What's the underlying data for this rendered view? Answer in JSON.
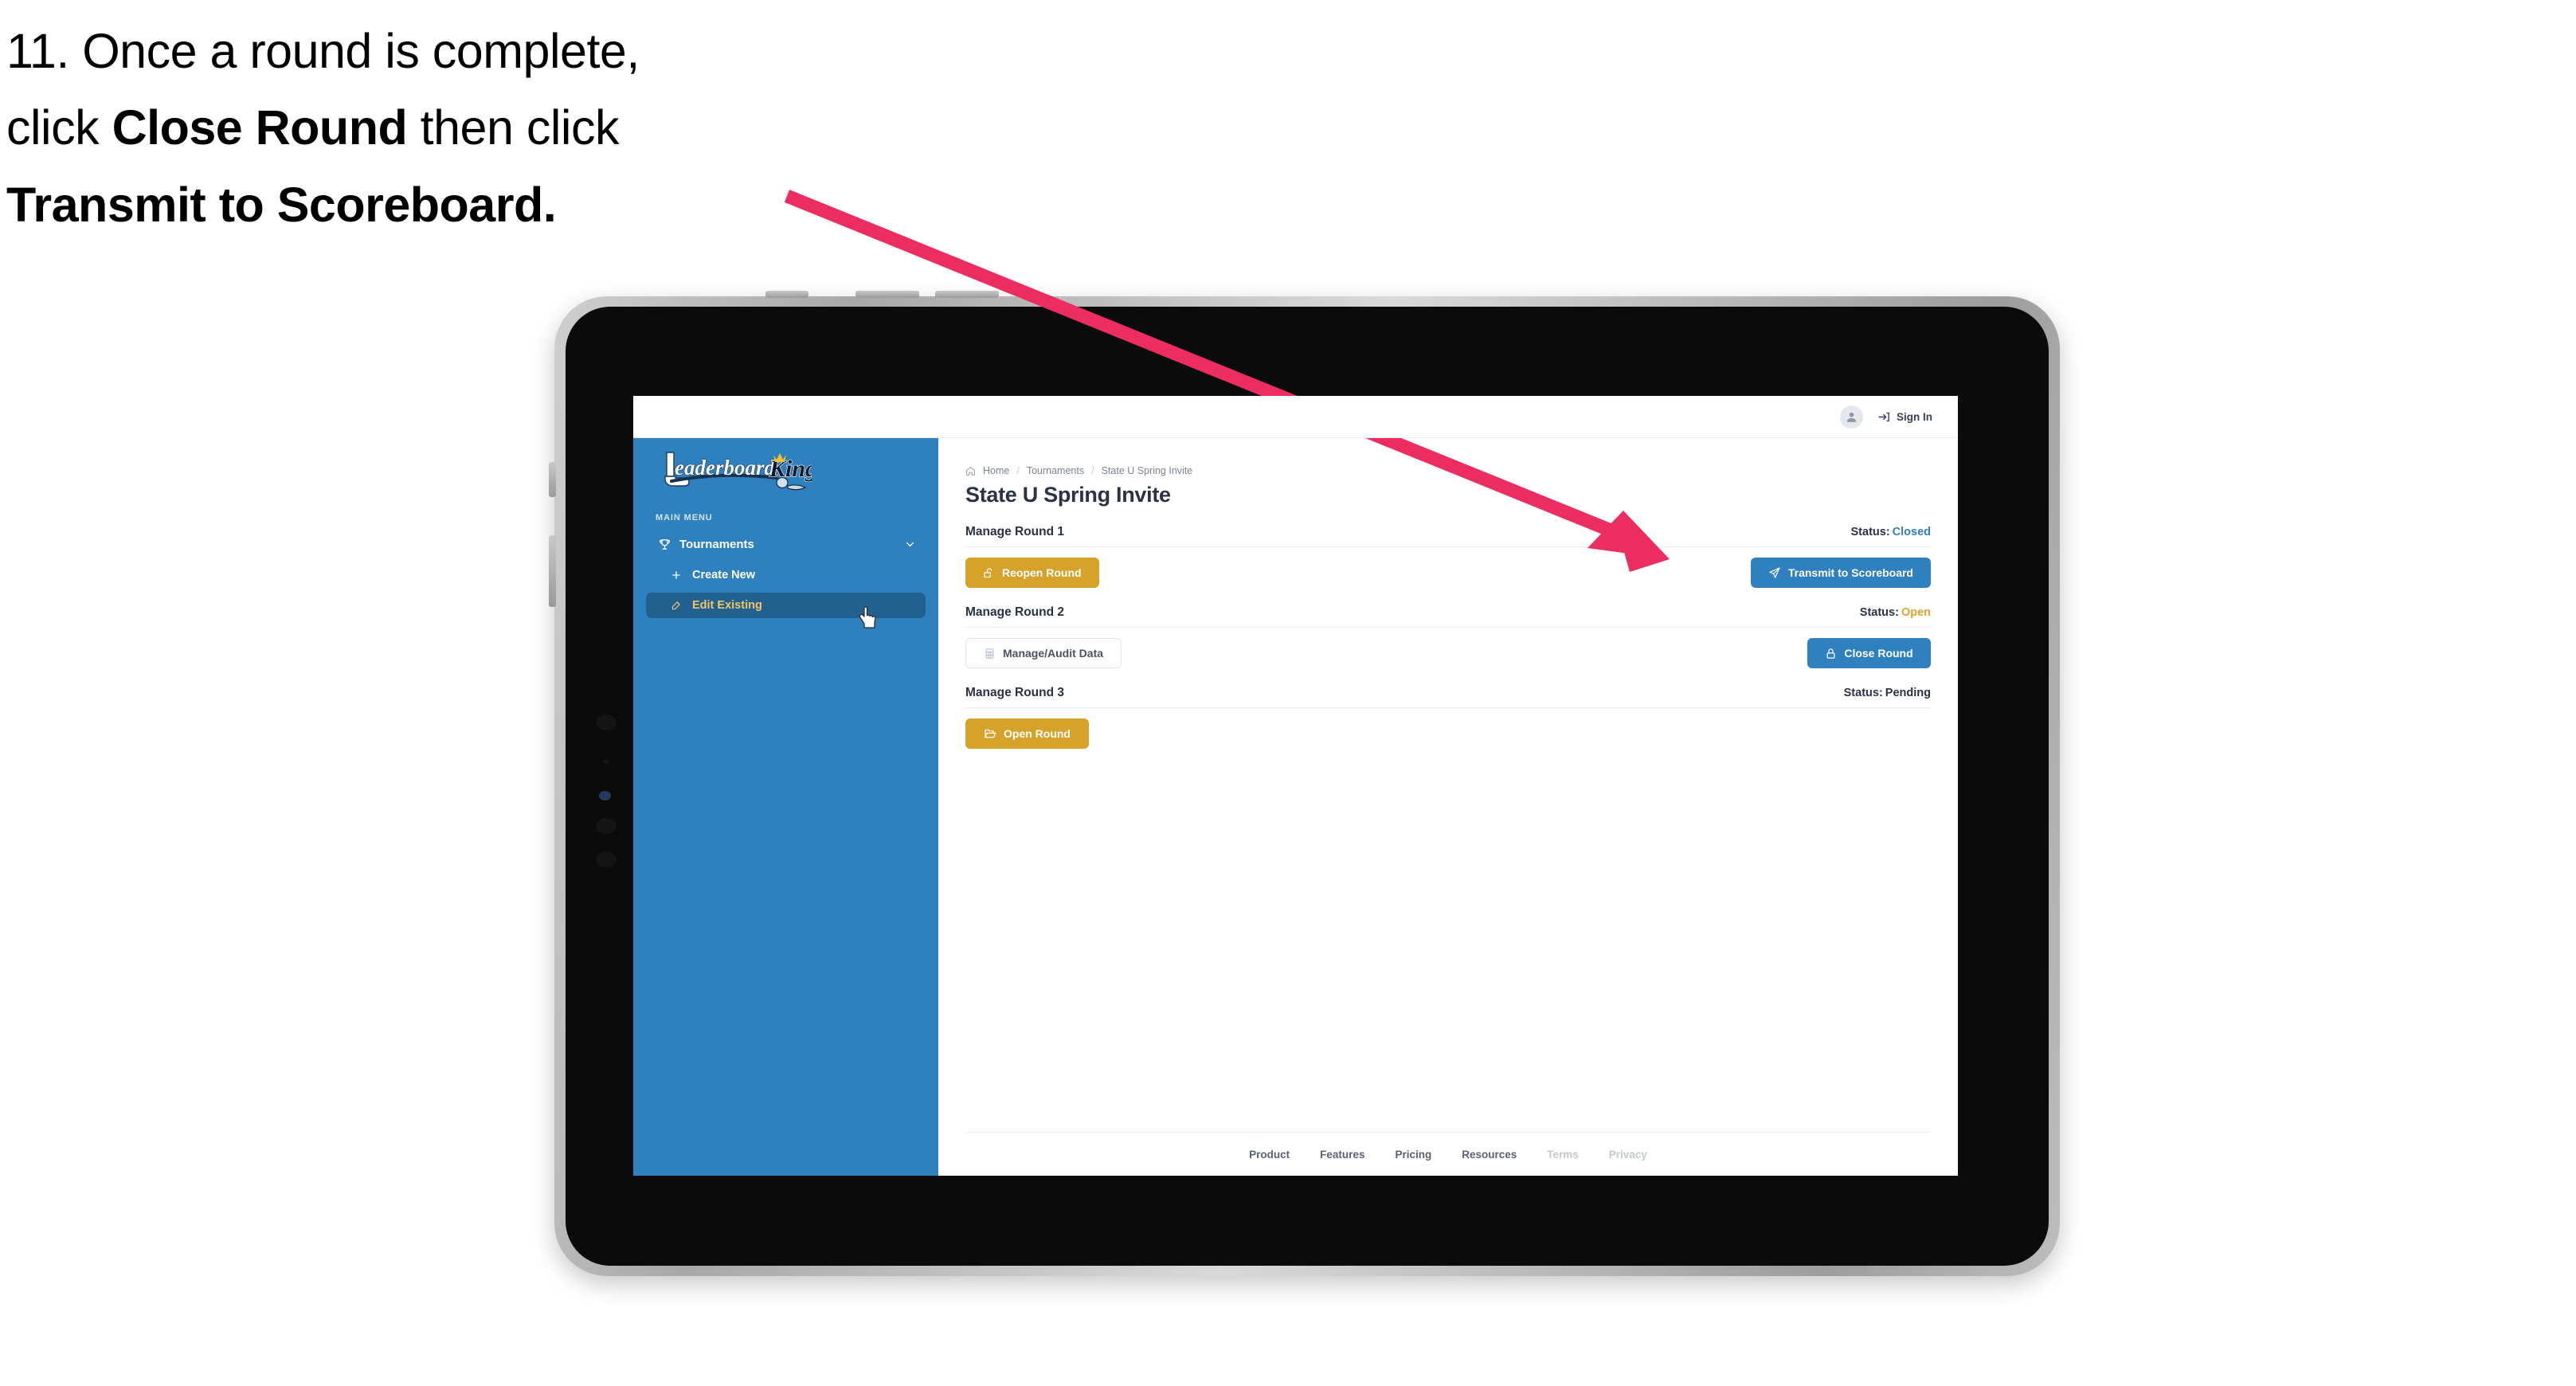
{
  "caption": {
    "line1_prefix": "11. Once a round is complete,",
    "line2_prefix": "click ",
    "line2_bold": "Close Round",
    "line2_suffix": " then click",
    "line3_bold": "Transmit to Scoreboard.",
    "arrow_color": "#ec2d62"
  },
  "topbar": {
    "avatar_icon": "user-avatar-icon",
    "signin_icon": "sign-in-arrow-icon",
    "signin_label": "Sign In"
  },
  "sidebar": {
    "bg_color": "#2f80bf",
    "logo_text_primary": "Leaderboard",
    "logo_text_secondary": "King",
    "section_label": "MAIN MENU",
    "nav": {
      "label": "Tournaments",
      "icon": "trophy-icon",
      "chevron": "chevron-down-icon"
    },
    "sub_items": [
      {
        "label": "Create New",
        "icon": "plus-icon",
        "active": false
      },
      {
        "label": "Edit Existing",
        "icon": "edit-pencil-icon",
        "active": true
      }
    ],
    "active_color": "#f0c468",
    "active_bg": "#22618f"
  },
  "breadcrumb": {
    "home_icon": "home-icon",
    "items": [
      "Home",
      "Tournaments",
      "State U Spring Invite"
    ],
    "separator": "/"
  },
  "page": {
    "title": "State U Spring Invite"
  },
  "rounds": [
    {
      "title": "Manage Round 1",
      "status_label": "Status:",
      "status_value": "Closed",
      "status_color": "#2f80bf",
      "left_button": {
        "label": "Reopen Round",
        "icon": "unlock-icon",
        "style": "gold"
      },
      "right_button": {
        "label": "Transmit to Scoreboard",
        "icon": "paper-plane-icon",
        "style": "blue"
      }
    },
    {
      "title": "Manage Round 2",
      "status_label": "Status:",
      "status_value": "Open",
      "status_color": "#e0a32e",
      "left_button": {
        "label": "Manage/Audit Data",
        "icon": "table-grid-icon",
        "style": "ghost"
      },
      "right_button": {
        "label": "Close Round",
        "icon": "lock-icon",
        "style": "blue"
      }
    },
    {
      "title": "Manage Round 3",
      "status_label": "Status:",
      "status_value": "Pending",
      "status_color": "#2b3245",
      "left_button": {
        "label": "Open Round",
        "icon": "folder-open-icon",
        "style": "gold"
      },
      "right_button": null
    }
  ],
  "footer": {
    "links": [
      {
        "label": "Product",
        "muted": false
      },
      {
        "label": "Features",
        "muted": false
      },
      {
        "label": "Pricing",
        "muted": false
      },
      {
        "label": "Resources",
        "muted": false
      },
      {
        "label": "Terms",
        "muted": true
      },
      {
        "label": "Privacy",
        "muted": true
      }
    ]
  },
  "cursor": {
    "icon": "pointing-hand-cursor"
  }
}
